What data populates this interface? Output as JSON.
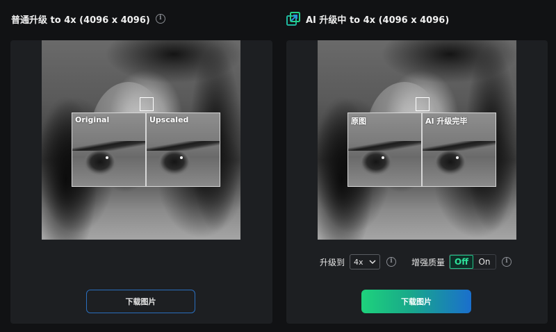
{
  "left_panel": {
    "title": "普通升级 to 4x (4096 x 4096)",
    "zoom_original_label": "Original",
    "zoom_upscaled_label": "Upscaled",
    "download_label": "下载图片"
  },
  "right_panel": {
    "title": "AI 升级中 to 4x (4096 x 4096)",
    "zoom_original_label": "原图",
    "zoom_upscaled_label": "AI 升级完毕",
    "upscale_to_label": "升级到",
    "upscale_value": "4x",
    "enhance_label": "增强质量",
    "toggle_off": "Off",
    "toggle_on": "On",
    "toggle_state": "Off",
    "download_label": "下载图片"
  },
  "icons": {
    "info": "info-icon",
    "ai": "ai-upscale-icon",
    "dropdown": "chevron-down-icon"
  },
  "colors": {
    "background": "#111214",
    "panel": "#1d1f22",
    "accent_green": "#1ed27c",
    "accent_blue": "#1a6fcd",
    "outline_button": "#2a6fbf"
  }
}
